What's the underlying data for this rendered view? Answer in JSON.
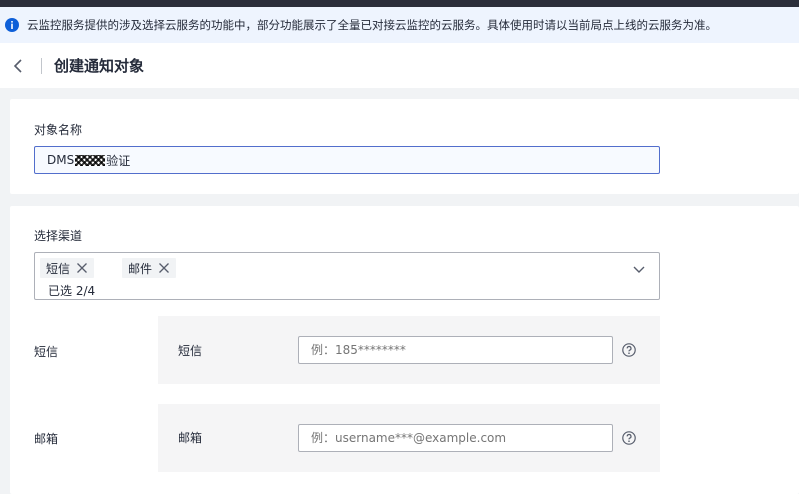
{
  "notice": {
    "icon": "info-icon",
    "text": "云监控服务提供的涉及选择云服务的功能中，部分功能展示了全量已对接云监控的云服务。具体使用时请以当前局点上线的云服务为准。"
  },
  "header": {
    "back_icon": "chevron-left-icon",
    "title": "创建通知对象"
  },
  "name_section": {
    "label": "对象名称",
    "value_prefix": "DMS",
    "value_suffix": "验证"
  },
  "channel_section": {
    "label": "选择渠道",
    "tags": [
      "短信",
      "邮件"
    ],
    "selected_count": "已选 2/4"
  },
  "sms": {
    "row_label": "短信",
    "field_label": "短信",
    "placeholder": "例：185********"
  },
  "email": {
    "row_label": "邮箱",
    "field_label": "邮箱",
    "placeholder": "例：username***@example.com"
  },
  "colors": {
    "accent": "#526ecc",
    "info": "#0e5fd8",
    "topbar": "#2b2e3a"
  }
}
